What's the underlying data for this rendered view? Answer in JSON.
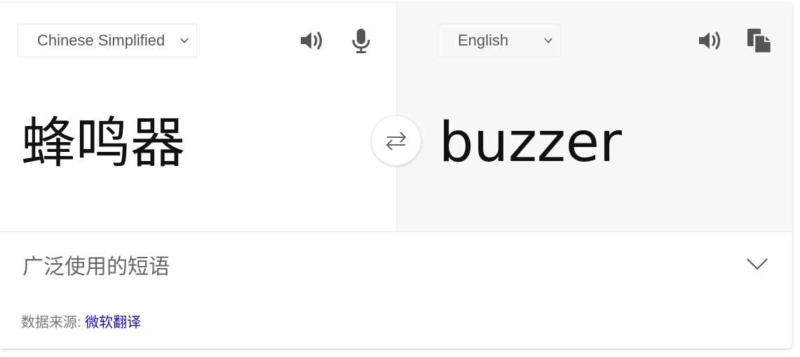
{
  "source": {
    "language": "Chinese Simplified",
    "text": "蜂鸣器"
  },
  "target": {
    "language": "English",
    "text": "buzzer"
  },
  "phrases": {
    "title": "广泛使用的短语"
  },
  "attribution": {
    "label": "数据来源:",
    "provider": "微软翻译"
  },
  "icons": {
    "source_speak": "speaker-icon",
    "mic": "microphone-icon",
    "swap": "swap-arrows-icon",
    "target_speak": "speaker-icon",
    "copy": "copy-icon",
    "expand": "chevron-down-icon"
  },
  "colors": {
    "icon": "#555555",
    "target_background": "#f8f8f8",
    "link": "#1a0dab"
  }
}
